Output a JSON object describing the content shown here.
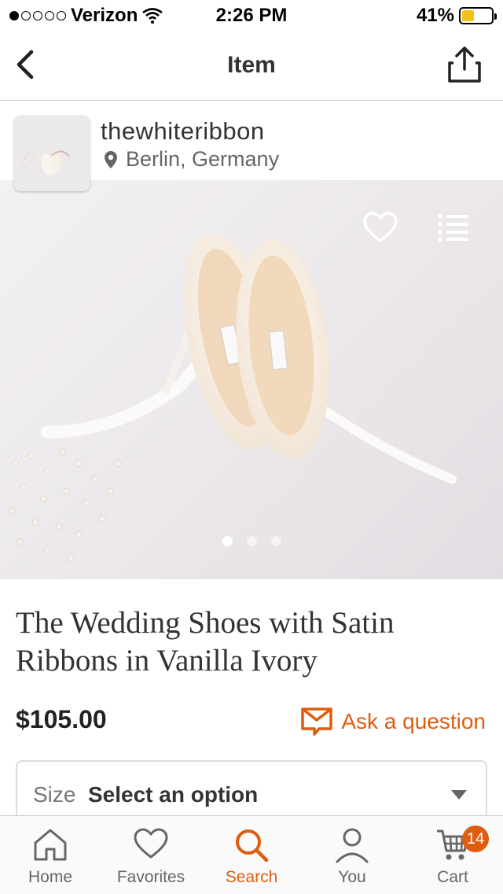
{
  "status_bar": {
    "carrier": "Verizon",
    "time": "2:26 PM",
    "battery": "41%",
    "battery_level": 0.41,
    "signal_bars": 1
  },
  "nav": {
    "title": "Item"
  },
  "shop": {
    "name": "thewhiteribbon",
    "location": "Berlin, Germany"
  },
  "image": {
    "dots_total": 3,
    "active_dot": 1
  },
  "product": {
    "title": "The Wedding Shoes with Satin Ribbons in Vanilla Ivory",
    "price": "$105.00",
    "ask_label": "Ask a question"
  },
  "size": {
    "label": "Size",
    "value": "Select an option"
  },
  "tabs": [
    {
      "label": "Home",
      "icon": "home-icon"
    },
    {
      "label": "Favorites",
      "icon": "heart-icon"
    },
    {
      "label": "Search",
      "icon": "search-icon"
    },
    {
      "label": "You",
      "icon": "user-icon"
    },
    {
      "label": "Cart",
      "icon": "cart-icon",
      "badge": "14"
    }
  ],
  "colors": {
    "accent": "#e05c0e",
    "battery": "#f2c21a"
  }
}
